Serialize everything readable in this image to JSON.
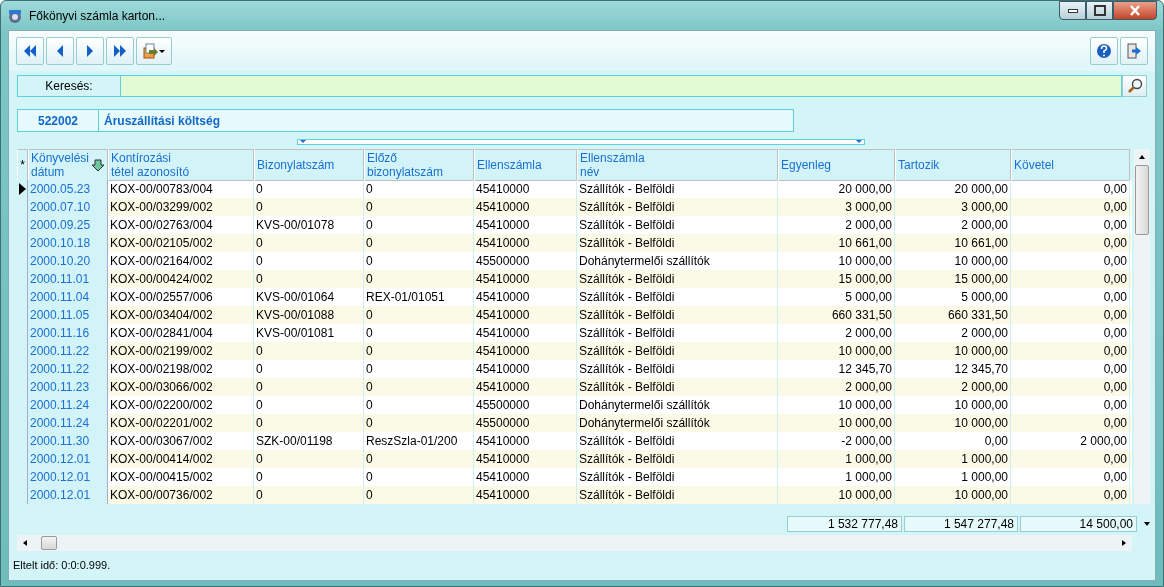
{
  "window": {
    "title": "Főkönyvi számla karton..."
  },
  "search": {
    "label": "Keresés:"
  },
  "account": {
    "code": "522002",
    "name": "Áruszállítási költség"
  },
  "table": {
    "marker_header": "*",
    "columns": [
      {
        "label": "Könyvelési\ndátum",
        "sorted": true
      },
      {
        "label": "Kontírozási\ntétel azonosító",
        "sorted": false
      },
      {
        "label": "Bizonylatszám",
        "sorted": false
      },
      {
        "label": "Előző\nbizonylatszám",
        "sorted": false
      },
      {
        "label": "Ellenszámla",
        "sorted": false
      },
      {
        "label": "Ellenszámla\nnév",
        "sorted": false
      },
      {
        "label": "Egyenleg",
        "sorted": false
      },
      {
        "label": "Tartozik",
        "sorted": false
      },
      {
        "label": "Követel",
        "sorted": false
      }
    ],
    "rows": [
      {
        "selected": true,
        "cells": [
          "2000.05.23",
          "KOX-00/00783/004",
          "0",
          "0",
          "45410000",
          "Szállítók - Belföldi",
          "20 000,00",
          "20 000,00",
          "0,00"
        ]
      },
      {
        "selected": false,
        "cells": [
          "2000.07.10",
          "KOX-00/03299/002",
          "0",
          "0",
          "45410000",
          "Szállítók - Belföldi",
          "3 000,00",
          "3 000,00",
          "0,00"
        ]
      },
      {
        "selected": false,
        "cells": [
          "2000.09.25",
          "KOX-00/02763/004",
          "KVS-00/01078",
          "0",
          "45410000",
          "Szállítók - Belföldi",
          "2 000,00",
          "2 000,00",
          "0,00"
        ]
      },
      {
        "selected": false,
        "cells": [
          "2000.10.18",
          "KOX-00/02105/002",
          "0",
          "0",
          "45410000",
          "Szállítók - Belföldi",
          "10 661,00",
          "10 661,00",
          "0,00"
        ]
      },
      {
        "selected": false,
        "cells": [
          "2000.10.20",
          "KOX-00/02164/002",
          "0",
          "0",
          "45500000",
          "Dohánytermelői szállítók",
          "10 000,00",
          "10 000,00",
          "0,00"
        ]
      },
      {
        "selected": false,
        "cells": [
          "2000.11.01",
          "KOX-00/00424/002",
          "0",
          "0",
          "45410000",
          "Szállítók - Belföldi",
          "15 000,00",
          "15 000,00",
          "0,00"
        ]
      },
      {
        "selected": false,
        "cells": [
          "2000.11.04",
          "KOX-00/02557/006",
          "KVS-00/01064",
          "REX-01/01051",
          "45410000",
          "Szállítók - Belföldi",
          "5 000,00",
          "5 000,00",
          "0,00"
        ]
      },
      {
        "selected": false,
        "cells": [
          "2000.11.05",
          "KOX-00/03404/002",
          "KVS-00/01088",
          "0",
          "45410000",
          "Szállítók - Belföldi",
          "660 331,50",
          "660 331,50",
          "0,00"
        ]
      },
      {
        "selected": false,
        "cells": [
          "2000.11.16",
          "KOX-00/02841/004",
          "KVS-00/01081",
          "0",
          "45410000",
          "Szállítók - Belföldi",
          "2 000,00",
          "2 000,00",
          "0,00"
        ]
      },
      {
        "selected": false,
        "cells": [
          "2000.11.22",
          "KOX-00/02199/002",
          "0",
          "0",
          "45410000",
          "Szállítók - Belföldi",
          "10 000,00",
          "10 000,00",
          "0,00"
        ]
      },
      {
        "selected": false,
        "cells": [
          "2000.11.22",
          "KOX-00/02198/002",
          "0",
          "0",
          "45410000",
          "Szállítók - Belföldi",
          "12 345,70",
          "12 345,70",
          "0,00"
        ]
      },
      {
        "selected": false,
        "cells": [
          "2000.11.23",
          "KOX-00/03066/002",
          "0",
          "0",
          "45410000",
          "Szállítók - Belföldi",
          "2 000,00",
          "2 000,00",
          "0,00"
        ]
      },
      {
        "selected": false,
        "cells": [
          "2000.11.24",
          "KOX-00/02200/002",
          "0",
          "0",
          "45500000",
          "Dohánytermelői szállítók",
          "10 000,00",
          "10 000,00",
          "0,00"
        ]
      },
      {
        "selected": false,
        "cells": [
          "2000.11.24",
          "KOX-00/02201/002",
          "0",
          "0",
          "45500000",
          "Dohánytermelői szállítók",
          "10 000,00",
          "10 000,00",
          "0,00"
        ]
      },
      {
        "selected": false,
        "cells": [
          "2000.11.30",
          "KOX-00/03067/002",
          "SZK-00/01198",
          "ReszSzla-01/200",
          "45410000",
          "Szállítók - Belföldi",
          "-2 000,00",
          "0,00",
          "2 000,00"
        ]
      },
      {
        "selected": false,
        "cells": [
          "2000.12.01",
          "KOX-00/00414/002",
          "0",
          "0",
          "45410000",
          "Szállítók - Belföldi",
          "1 000,00",
          "1 000,00",
          "0,00"
        ]
      },
      {
        "selected": false,
        "cells": [
          "2000.12.01",
          "KOX-00/00415/002",
          "0",
          "0",
          "45410000",
          "Szállítók - Belföldi",
          "1 000,00",
          "1 000,00",
          "0,00"
        ]
      },
      {
        "selected": false,
        "cells": [
          "2000.12.01",
          "KOX-00/00736/002",
          "0",
          "0",
          "45410000",
          "Szállítók - Belföldi",
          "10 000,00",
          "10 000,00",
          "0,00"
        ]
      }
    ],
    "totals": [
      "1 532 777,48",
      "1 547 277,48",
      "14 500,00"
    ]
  },
  "status_bar": {
    "text": "Eltelt idő: 0:0:0.999."
  }
}
